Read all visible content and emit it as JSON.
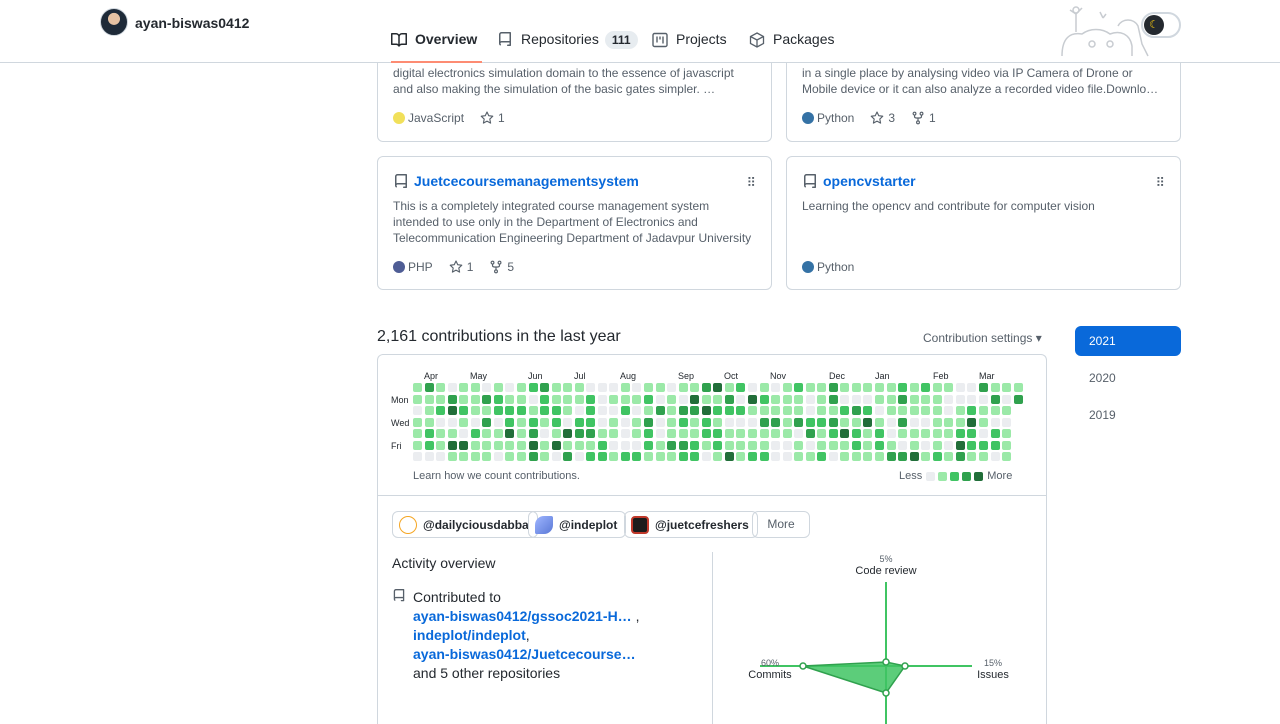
{
  "header": {
    "username": "ayan-biswas0412",
    "tabs": [
      {
        "label": "Overview",
        "icon": "book-icon",
        "active": true
      },
      {
        "label": "Repositories",
        "icon": "repo-icon",
        "count": "111"
      },
      {
        "label": "Projects",
        "icon": "project-icon"
      },
      {
        "label": "Packages",
        "icon": "package-icon"
      }
    ]
  },
  "repos": [
    {
      "name": "",
      "description": "digital electronics simulation domain to the essence of javascript and also making the simulation of the basic gates simpler. …",
      "language": "JavaScript",
      "language_color": "#f1e05a",
      "stars": "1",
      "forks": ""
    },
    {
      "name": "",
      "description": "in a single place by analysing video via IP Camera of Drone or Mobile device or it can also analyze a recorded video file.Downlo…",
      "language": "Python",
      "language_color": "#3572A5",
      "stars": "3",
      "forks": "1"
    },
    {
      "name": "Juetcecoursemanagementsystem",
      "description": "This is a completely integrated course management system intended to use only in the Department of Electronics and Telecommunication Engineering Department of Jadavpur University",
      "language": "PHP",
      "language_color": "#4F5D95",
      "stars": "1",
      "forks": "5"
    },
    {
      "name": "opencvstarter",
      "description": "Learning the opencv and contribute for computer vision",
      "language": "Python",
      "language_color": "#3572A5",
      "stars": "",
      "forks": ""
    }
  ],
  "contributions": {
    "title": "2,161 contributions in the last year",
    "settings_label": "Contribution settings ▾",
    "months": [
      "Apr",
      "May",
      "Jun",
      "Jul",
      "Aug",
      "Sep",
      "Oct",
      "Nov",
      "Dec",
      "Jan",
      "Feb",
      "Mar"
    ],
    "days": [
      "Mon",
      "Wed",
      "Fri"
    ],
    "learn_text": "Learn how we count contributions.",
    "legend_less": "Less",
    "legend_more": "More",
    "colors": [
      "#ebedf0",
      "#9be9a8",
      "#40c463",
      "#30a14e",
      "#216e39"
    ]
  },
  "years": [
    "2021",
    "2020",
    "2019"
  ],
  "orgs": [
    {
      "handle": "@dailyciousdabba",
      "logo_color": "#f5a623"
    },
    {
      "handle": "@indeplot",
      "logo_color": "#6f8fd8"
    },
    {
      "handle": "@juetcefreshers",
      "logo_color": "#c0392b"
    }
  ],
  "orgs_more": "More",
  "activity": {
    "title": "Activity overview",
    "contributed_to": "Contributed to",
    "repos": [
      "ayan-biswas0412/gssoc2021-H…",
      "indeplot/indeplot",
      "ayan-biswas0412/Juetcecourse…"
    ],
    "others": "and 5 other repositories",
    "radar": {
      "code_review": {
        "label": "Code review",
        "pct": "5%"
      },
      "commits": {
        "label": "Commits",
        "pct": "60%"
      },
      "issues": {
        "label": "Issues",
        "pct": "15%"
      }
    },
    "accent": "#40c463"
  }
}
